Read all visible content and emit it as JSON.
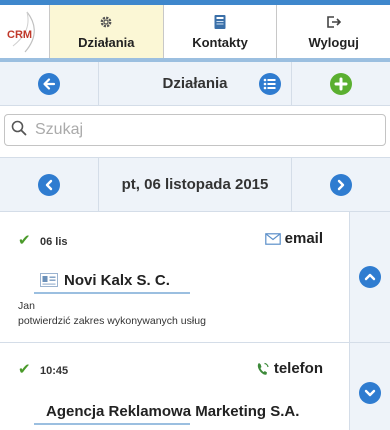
{
  "header": {
    "logo_text": "CRM",
    "nav": [
      {
        "label": "Działania",
        "icon": "gear-icon",
        "active": true
      },
      {
        "label": "Kontakty",
        "icon": "address-book-icon",
        "active": false
      },
      {
        "label": "Wyloguj",
        "icon": "logout-icon",
        "active": false
      }
    ]
  },
  "toolbar": {
    "title": "Działania"
  },
  "search": {
    "placeholder": "Szukaj",
    "value": ""
  },
  "date_nav": {
    "label": "pt, 06 listopada 2015"
  },
  "items": [
    {
      "done": true,
      "date": "06 lis",
      "type": "email",
      "type_icon": "envelope-icon",
      "company": "Novi Kalx S. C.",
      "person": "Jan",
      "description": "potwierdzić zakres wykonywanych usług",
      "toggle": "collapse"
    },
    {
      "done": true,
      "date": "10:45",
      "type": "telefon",
      "type_icon": "phone-icon",
      "company": "Agencja Reklamowa Marketing S.A.",
      "toggle": "expand"
    }
  ],
  "colors": {
    "accent": "#2f7cd0",
    "add": "#5aaf30",
    "active_tab": "#fbf7d5",
    "bar": "#eef3f9"
  }
}
